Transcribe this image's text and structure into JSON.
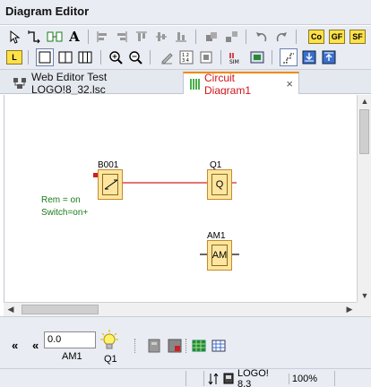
{
  "window": {
    "title": "Diagram Editor"
  },
  "toolbar_row2": {
    "label_L": "L"
  },
  "toolbar_row1_badges": {
    "co": "Co",
    "gf": "GF",
    "sf": "SF"
  },
  "tabs": [
    {
      "label": "Web Editor Test LOGO!8_32.lsc",
      "active": false
    },
    {
      "label": "Circuit Diagram1",
      "active": true,
      "close": "×"
    }
  ],
  "diagram": {
    "blocks": [
      {
        "id": "B001",
        "symbol": ""
      },
      {
        "id": "Q1",
        "symbol": "Q"
      },
      {
        "id": "AM1",
        "symbol": "AM"
      }
    ],
    "params": [
      "Rem = on",
      "Switch=on+"
    ]
  },
  "simulation": {
    "collapse_left": "«",
    "collapse_left2": "«",
    "analog_value": "0.0",
    "analog_label": "AM1",
    "output_label": "Q1"
  },
  "status": {
    "device": "LOGO! 8.3",
    "zoom": "100%"
  },
  "colors": {
    "accent_tab": "#f08a00",
    "active_tab_text": "#d0151b",
    "block_fill": "#ffe6a0",
    "wire": "#d02020",
    "param_text": "#1a7a1a"
  }
}
